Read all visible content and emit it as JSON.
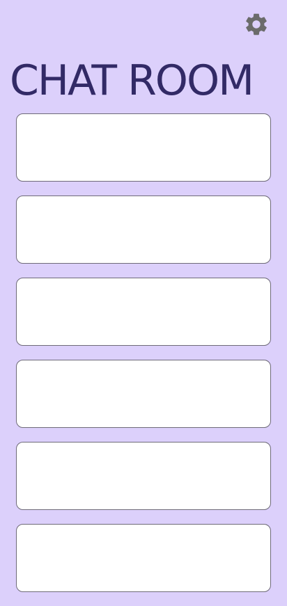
{
  "header": {
    "title": "CHAT ROOM",
    "settings_icon": "gear-icon"
  },
  "rooms": [
    {
      "label": ""
    },
    {
      "label": ""
    },
    {
      "label": ""
    },
    {
      "label": ""
    },
    {
      "label": ""
    },
    {
      "label": ""
    }
  ],
  "colors": {
    "background": "#dcd0fb",
    "title": "#322a66",
    "card_background": "#ffffff",
    "card_border": "#6e6a78",
    "icon": "#6b6b6b"
  }
}
